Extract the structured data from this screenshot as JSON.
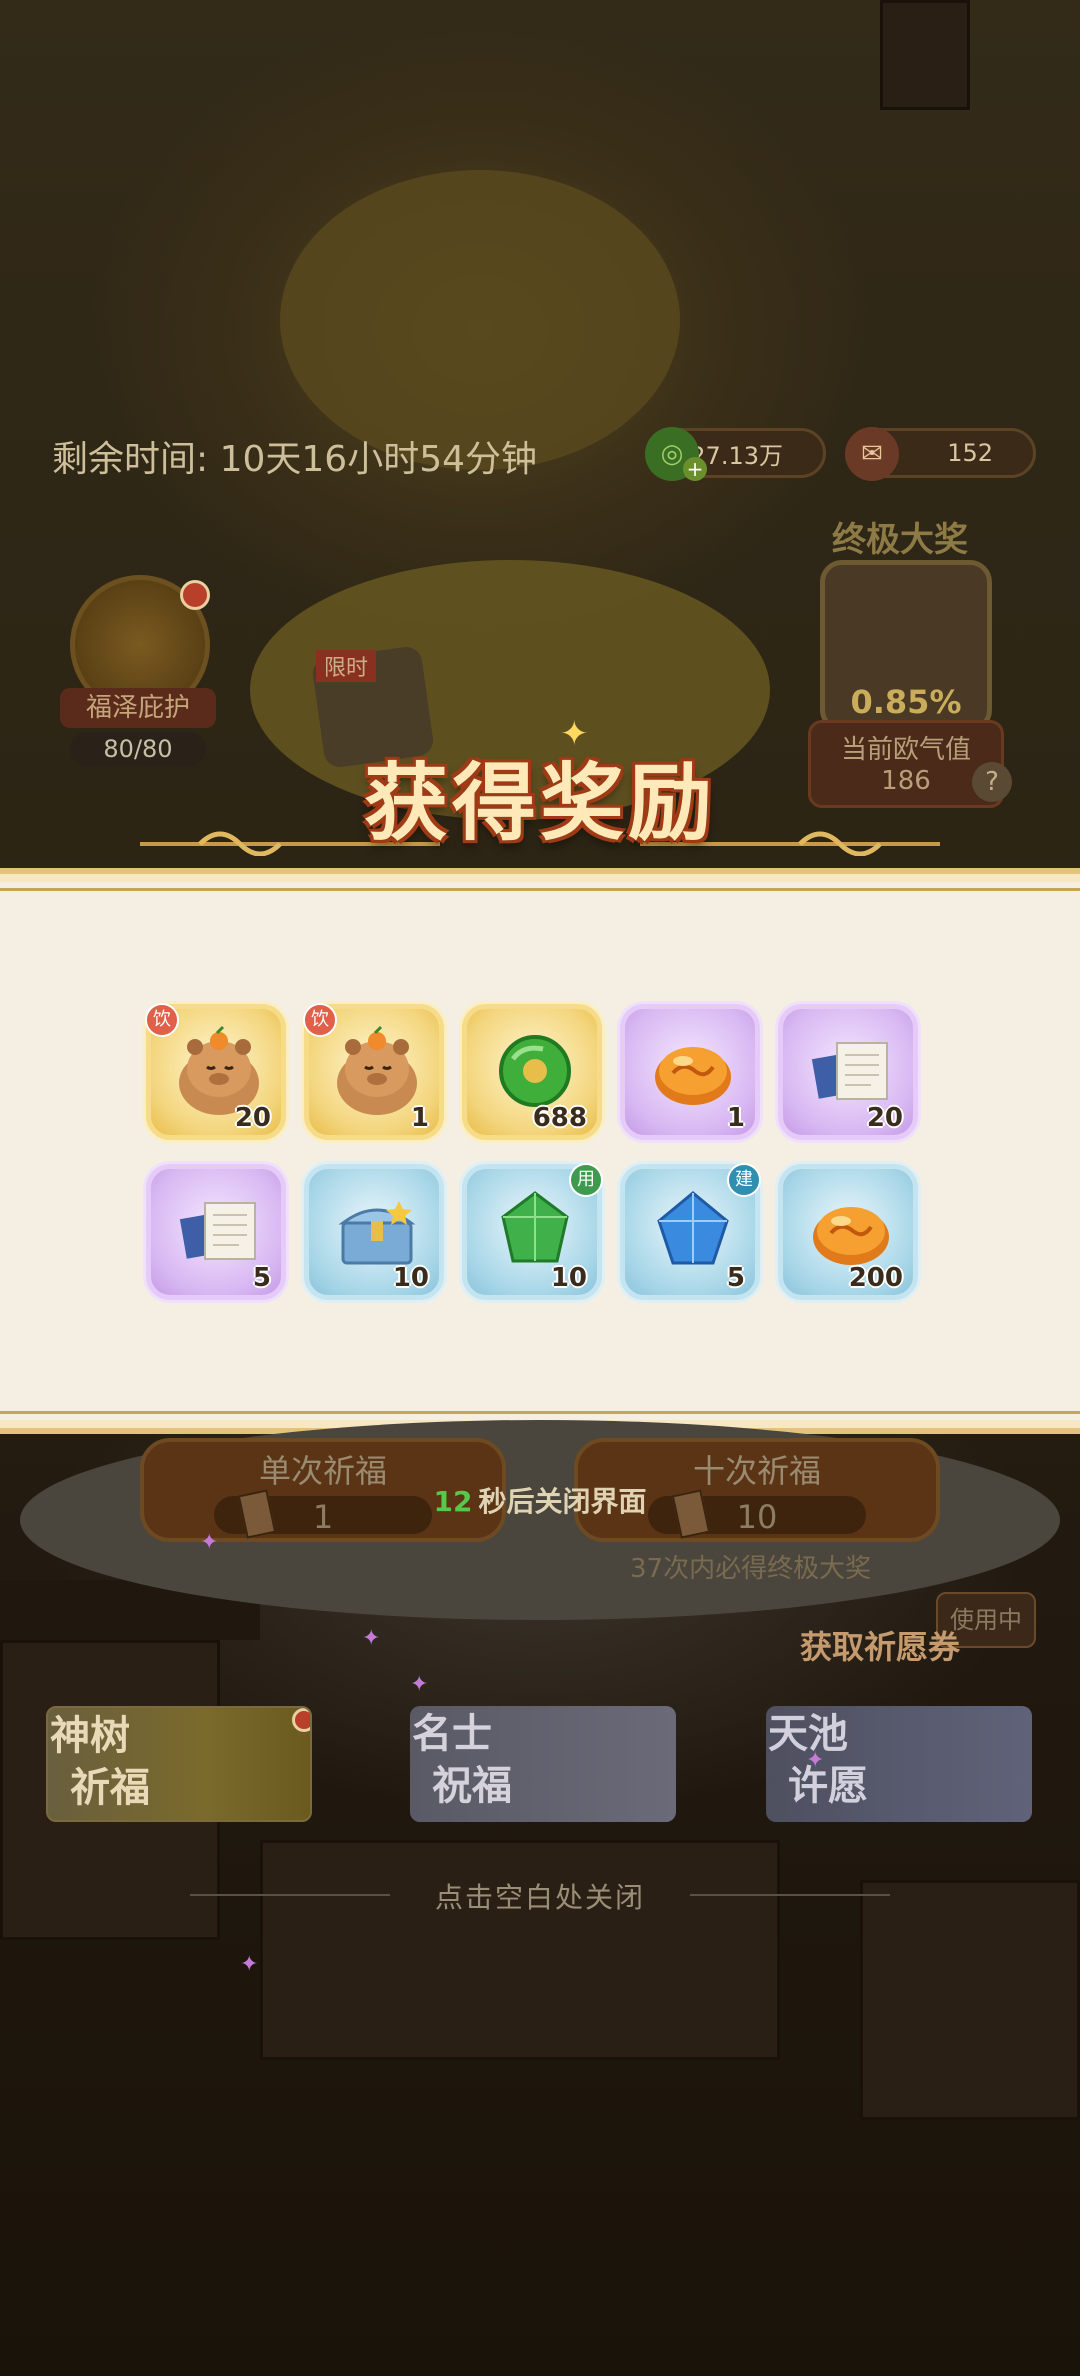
{
  "header": {
    "timer_text": "剩余时间: 10天16小时54分钟",
    "jade_amount": "27.13万",
    "ticket_amount": "152"
  },
  "grand_prize": {
    "label": "终极大奖",
    "rate": "0.85%",
    "luck_label": "当前欧气值",
    "luck_value": "186"
  },
  "protection": {
    "label": "福泽庇护",
    "count": "80/80"
  },
  "limited_tag": "限时",
  "reward_popup": {
    "title": "获得奖励",
    "items": [
      {
        "name": "capybara-orange-sticker",
        "count": "20",
        "rarity": "gold",
        "tag": "饮"
      },
      {
        "name": "capybara-orange-sticker",
        "count": "1",
        "rarity": "gold",
        "tag": "饮"
      },
      {
        "name": "jade-coin",
        "count": "688",
        "rarity": "gold",
        "tag": ""
      },
      {
        "name": "amber-stone",
        "count": "1",
        "rarity": "purple",
        "tag": ""
      },
      {
        "name": "scroll-book",
        "count": "20",
        "rarity": "purple",
        "tag": ""
      },
      {
        "name": "scroll-book",
        "count": "5",
        "rarity": "purple",
        "tag": ""
      },
      {
        "name": "treasure-chest",
        "count": "10",
        "rarity": "blue",
        "tag": ""
      },
      {
        "name": "green-gem",
        "count": "10",
        "rarity": "blue",
        "tag": "用"
      },
      {
        "name": "blue-gem",
        "count": "5",
        "rarity": "blue",
        "tag": "建"
      },
      {
        "name": "amber-stone",
        "count": "200",
        "rarity": "blue",
        "tag": ""
      }
    ],
    "auto_close_seconds": "12",
    "auto_close_text": "秒后关闭界面"
  },
  "pray": {
    "single_label": "单次祈福",
    "single_cost": "1",
    "ten_label": "十次祈福",
    "ten_cost": "10",
    "guarantee_text": "37次内必得终极大奖",
    "get_ticket_label": "获取祈愿券",
    "side_label": "使用中"
  },
  "modes": [
    {
      "line1": "神树",
      "line2": "祈福"
    },
    {
      "line1": "名士",
      "line2": "祝福"
    },
    {
      "line1": "天池",
      "line2": "许愿"
    }
  ],
  "close_hint": "点击空白处关闭",
  "colors": {
    "panel_bg": "#f4efe2",
    "gold_frame": "#f3d57d",
    "purple_frame": "#d8b8f2",
    "blue_frame": "#a9d7e8",
    "countdown": "#58c84a",
    "title_outline": "#a03a14"
  }
}
